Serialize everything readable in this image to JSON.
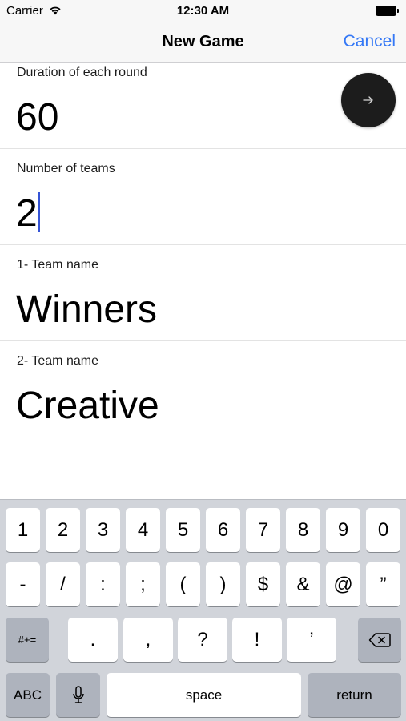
{
  "status_bar": {
    "carrier": "Carrier",
    "time": "12:30 AM"
  },
  "nav": {
    "title": "New Game",
    "cancel_label": "Cancel"
  },
  "form": {
    "duration": {
      "label": "Duration of each round",
      "value": "60"
    },
    "teams": {
      "label": "Number of teams",
      "value": "2"
    },
    "team1": {
      "label": "1- Team name",
      "value": "Winners"
    },
    "team2": {
      "label": "2- Team name",
      "value": "Creative"
    }
  },
  "next_button": {
    "icon": "arrow-right-icon"
  },
  "keyboard": {
    "row1": [
      "1",
      "2",
      "3",
      "4",
      "5",
      "6",
      "7",
      "8",
      "9",
      "0"
    ],
    "row2": [
      "-",
      "/",
      ":",
      ";",
      "(",
      ")",
      "$",
      "&",
      "@",
      "”"
    ],
    "row3": [
      ".",
      ",",
      "?",
      "!",
      "’"
    ],
    "symbols_label": "#+=",
    "abc_label": "ABC",
    "space_label": "space",
    "return_label": "return"
  },
  "colors": {
    "accent": "#3478f6",
    "caret": "#3554d6",
    "fab": "#1c1c1c",
    "keyboard_bg": "#d1d4da"
  }
}
